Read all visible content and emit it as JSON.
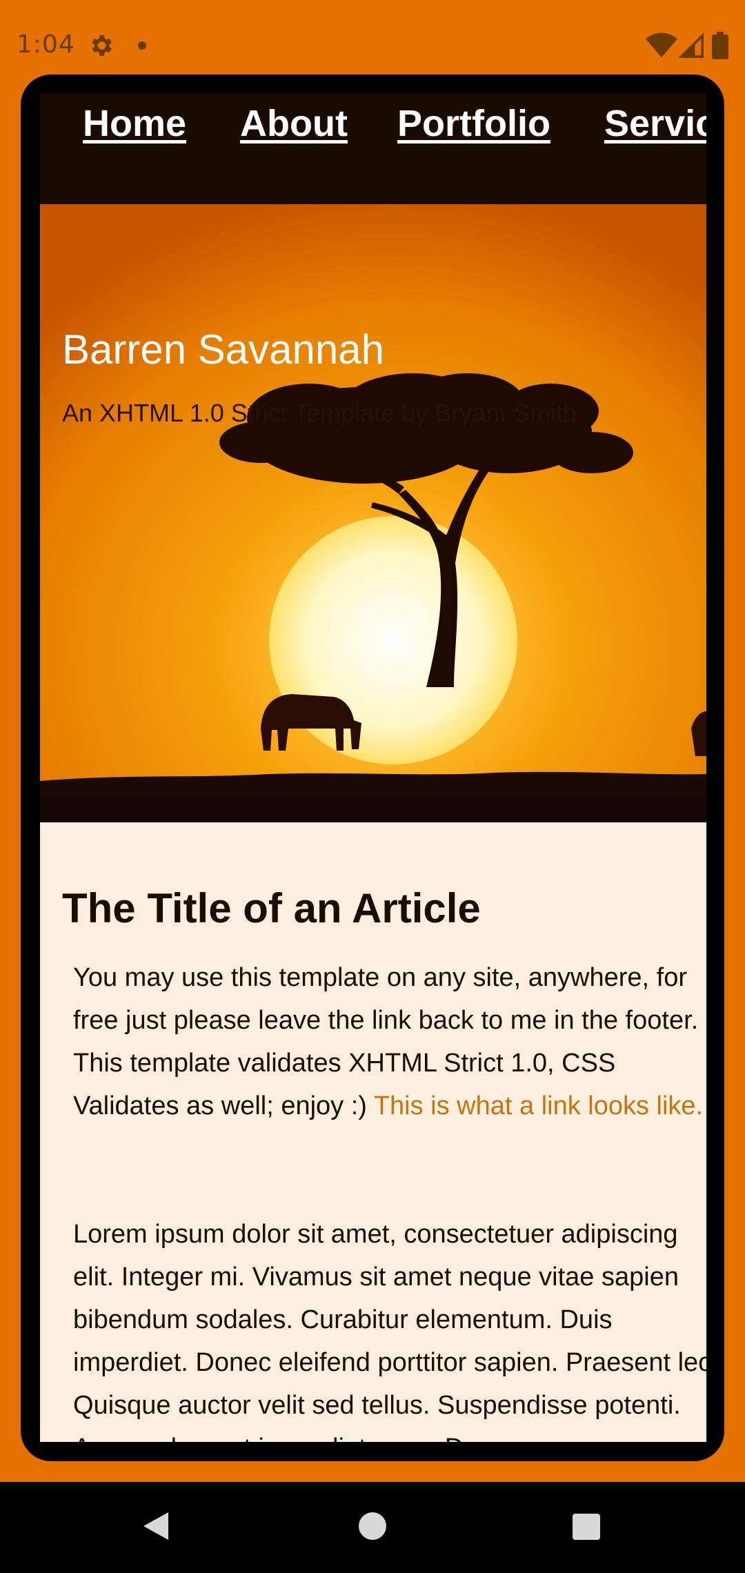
{
  "status_bar": {
    "time": "1:04",
    "icons": [
      "gear-icon",
      "notification-dot",
      "wifi-icon",
      "signal-icon",
      "battery-icon"
    ]
  },
  "nav": {
    "items": [
      {
        "label": "Home"
      },
      {
        "label": "About"
      },
      {
        "label": "Portfolio"
      },
      {
        "label": "Services"
      }
    ]
  },
  "header": {
    "title": "Barren Savannah",
    "subtitle": "An XHTML 1.0 Strict Template by Bryant Smith"
  },
  "article": {
    "title": "The Title of an Article",
    "paragraph1": "You may use this template on any site, anywhere, for free just please leave the link back to me in the footer. This template validates XHTML Strict 1.0, CSS Validates as well; enjoy :)",
    "link_text": "This is what a link looks like.",
    "paragraph2": "Lorem ipsum dolor sit amet, consectetuer adipiscing elit. Integer mi. Vivamus sit amet neque vitae sapien bibendum sodales. Curabitur elementum. Duis imperdiet. Donec eleifend porttitor sapien. Praesent leo. Quisque auctor velit sed tellus. Suspendisse potenti. Aenean laoreet imperdiet nunc. Donec"
  },
  "colors": {
    "background": "#e57200",
    "nav_background": "#1a0b02",
    "content_background": "#fdefe0",
    "link": "#c5750f"
  }
}
